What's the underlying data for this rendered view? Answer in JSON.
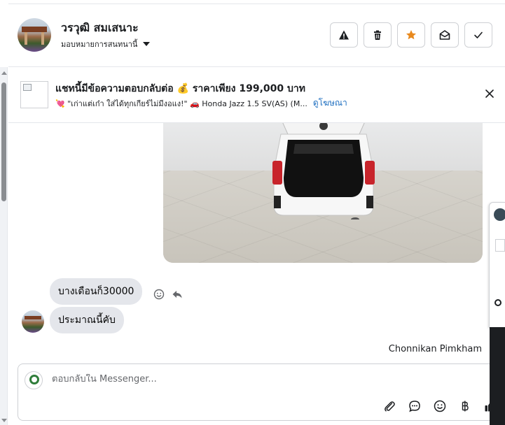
{
  "header": {
    "contact_name": "วรวุฒิ สมเสนาะ",
    "assign_label": "มอบหมายการสนทนานี้",
    "actions": [
      {
        "name": "report-button",
        "icon": "warning-icon"
      },
      {
        "name": "delete-button",
        "icon": "trash-icon"
      },
      {
        "name": "star-button",
        "icon": "star-icon",
        "color": "#e8891e"
      },
      {
        "name": "mark-unread-button",
        "icon": "envelope-open-icon"
      },
      {
        "name": "mark-done-button",
        "icon": "check-icon"
      }
    ]
  },
  "ad": {
    "title": "แชทนี้มีข้อความตอบกลับต่อ 💰 ราคาเพียง 199,000 บาท",
    "subtitle": "💘 \"เก่าแต่เก๋า ใส่ได้ทุกเกียร์ไม่มีงอแง!\" 🚗 Honda Jazz 1.5 SV(AS) (M...",
    "link_label": "ดูโฆษณา"
  },
  "messages": [
    {
      "text": "บางเดือนก็30000",
      "side": "incoming"
    },
    {
      "text": "ประมาณนี้คับ",
      "side": "incoming"
    }
  ],
  "agent_name": "Chonnikan Pimkham",
  "reply": {
    "placeholder": "ตอบกลับใน Messenger...",
    "tools": [
      "attach-icon",
      "saved-reply-icon",
      "emoji-icon",
      "baht-icon",
      "thumbs-up-icon"
    ]
  },
  "colors": {
    "accent_link": "#1e6fc0",
    "star": "#e8891e",
    "bubble": "#e4e6eb"
  }
}
